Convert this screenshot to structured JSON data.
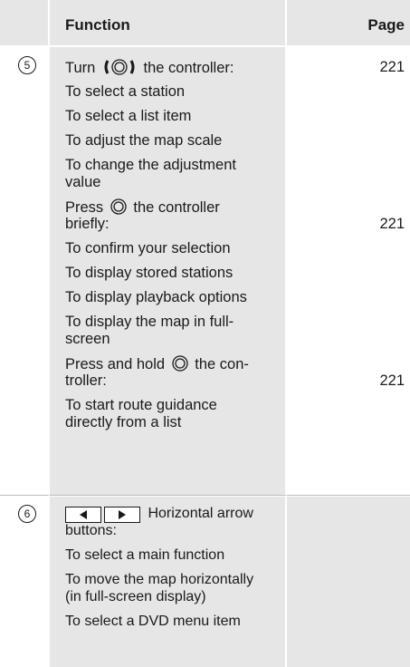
{
  "header": {
    "function": "Function",
    "page": "Page"
  },
  "rows": [
    {
      "number": "5",
      "turn_prefix": "Turn",
      "turn_suffix": "the controller:",
      "lines": [
        "To select a station",
        "To select a list item",
        "To adjust the map scale",
        "To change the adjustment",
        "value"
      ],
      "press_prefix": "Press",
      "press_suffix": "the controller",
      "press_cont": "briefly:",
      "press_lines": [
        "To confirm your selection",
        "To display stored stations",
        "To display playback options",
        "To display the map in full-",
        "screen"
      ],
      "hold_prefix": "Press and hold",
      "hold_suffix": "the con-",
      "hold_cont": "troller:",
      "hold_lines": [
        "To start route guidance",
        "directly from a list"
      ],
      "pages": [
        "221",
        "221",
        "221"
      ]
    },
    {
      "number": "6",
      "arrows_suffix": "Horizontal arrow",
      "arrows_cont": "buttons:",
      "lines": [
        "To select a main function",
        "To move the map horizontally",
        "(in full-screen display)",
        "To select a DVD menu item"
      ]
    }
  ],
  "icons": {
    "rotate": "controller-rotate-icon",
    "press": "controller-press-icon",
    "left": "arrow-left-icon",
    "right": "arrow-right-icon"
  },
  "colors": {
    "shade": "#e6e6e6",
    "text": "#1a1a1a"
  }
}
